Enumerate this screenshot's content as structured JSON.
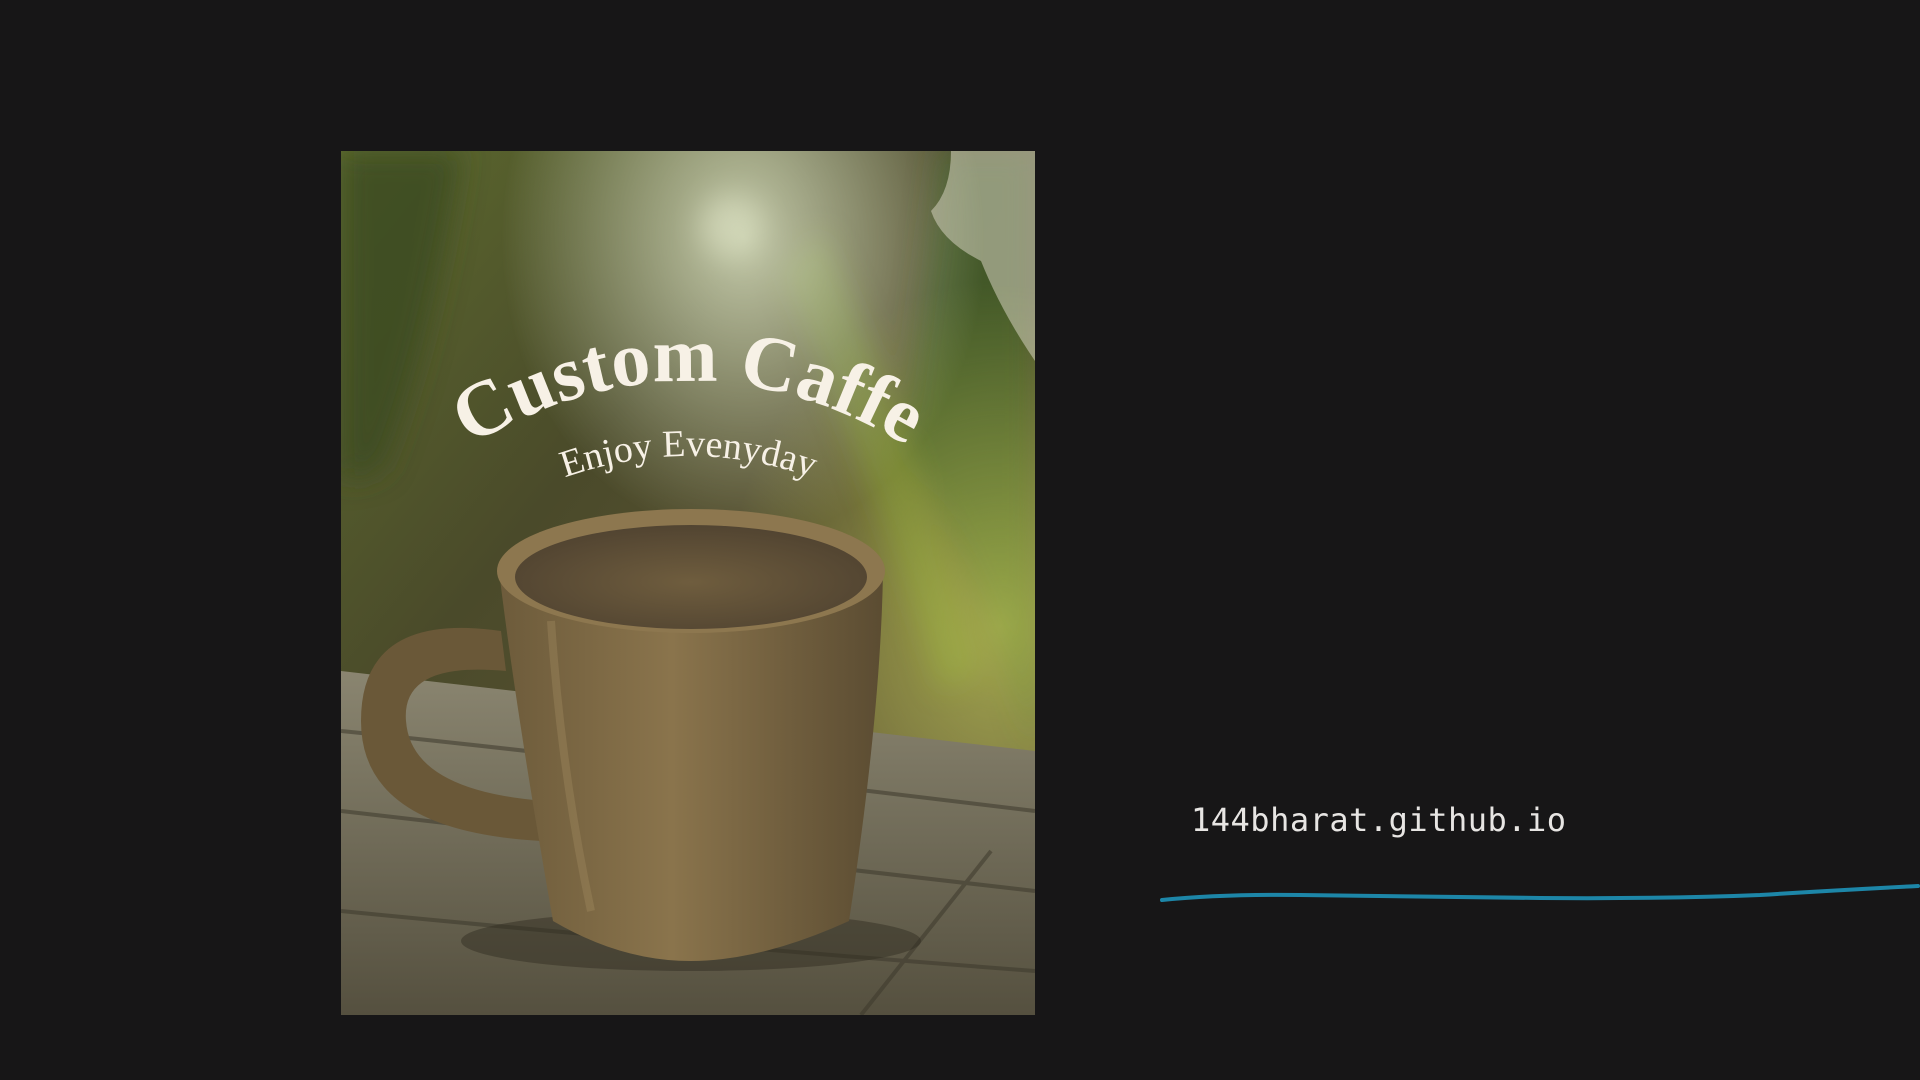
{
  "promo": {
    "title": "Custom Caffe",
    "tagline": "Enjoy Evenyday",
    "url": "144bharat.github.io"
  },
  "colors": {
    "background": "#171617",
    "title_text": "#f7f1e6",
    "url_text": "#e7e5e3",
    "underline": "#1d86a8"
  },
  "icons": {
    "mug": "coffee-mug-illustration",
    "underline": "wavy-underline"
  }
}
